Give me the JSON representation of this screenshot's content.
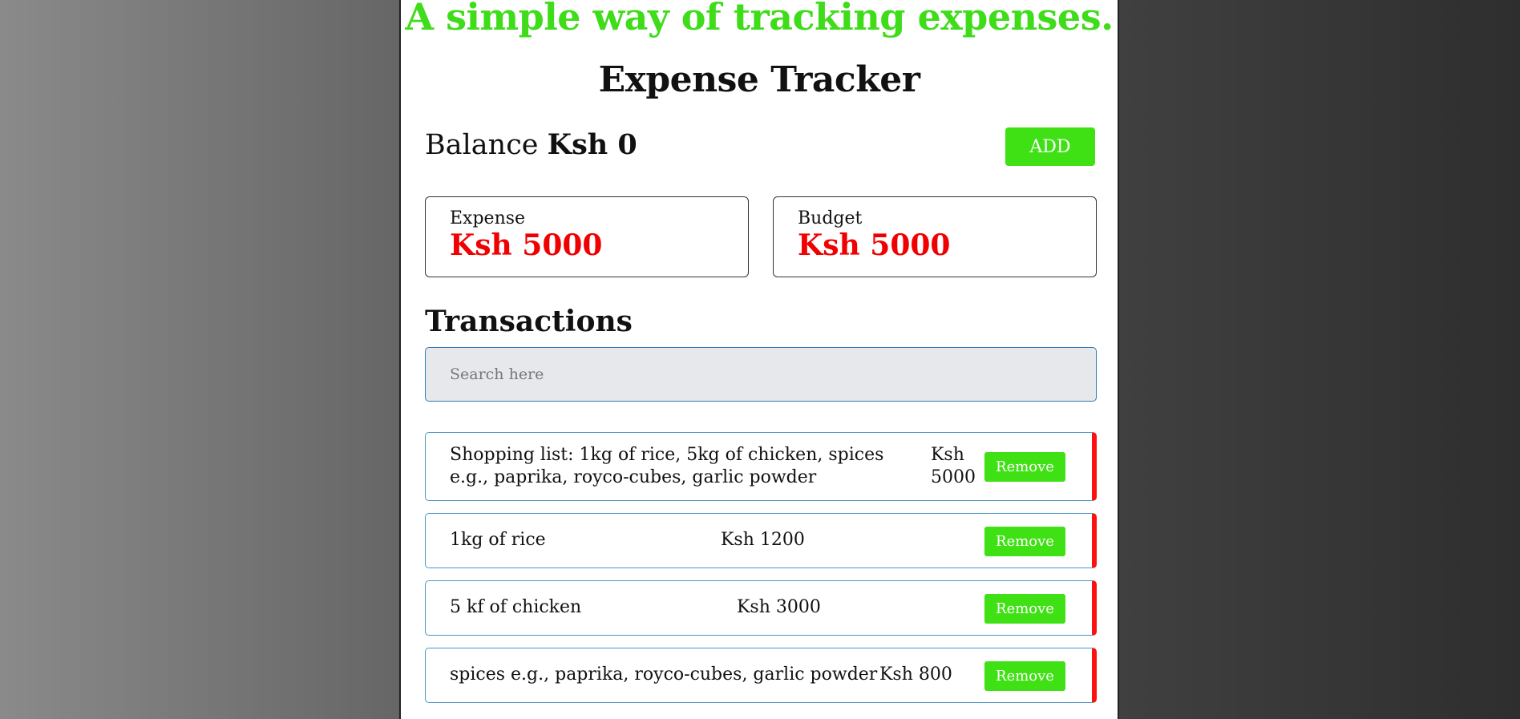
{
  "header": {
    "tagline": "A simple way of tracking expenses.",
    "title": "Expense Tracker"
  },
  "balance": {
    "label": "Balance",
    "value": "Ksh 0",
    "add_label": "ADD"
  },
  "cards": {
    "expense": {
      "label": "Expense",
      "value": "Ksh 5000"
    },
    "budget": {
      "label": "Budget",
      "value": "Ksh 5000"
    }
  },
  "transactions": {
    "title": "Transactions",
    "search_placeholder": "Search here",
    "remove_label": "Remove",
    "items": [
      {
        "description": "Shopping list: 1kg of rice, 5kg of chicken, spices e.g., paprika, royco-cubes, garlic powder",
        "amount_line1": "Ksh",
        "amount_line2": "5000"
      },
      {
        "description": "1kg of rice",
        "amount": "Ksh 1200"
      },
      {
        "description": "5 kf of chicken",
        "amount": "Ksh 3000"
      },
      {
        "description": "spices e.g., paprika, royco-cubes, garlic powder",
        "amount": "Ksh 800"
      }
    ]
  },
  "colors": {
    "accent_green": "#3fe114",
    "tagline_green": "#3fdc1a",
    "alert_red": "#f00000",
    "input_border_blue": "#2f7ab8"
  }
}
